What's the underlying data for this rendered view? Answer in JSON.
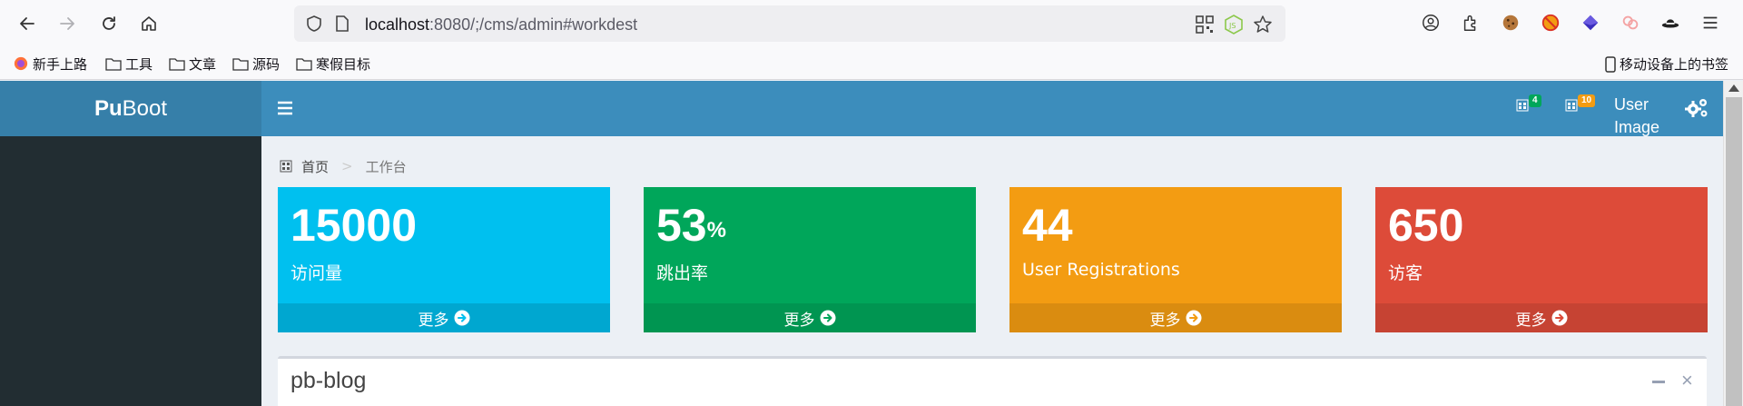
{
  "browser": {
    "url_host": "localhost",
    "url_rest": ":8080/;/cms/admin#workdest",
    "bookmarks": [
      "新手上路",
      "工具",
      "文章",
      "源码",
      "寒假目标"
    ],
    "mobile_bookmarks": "移动设备上的书签"
  },
  "header": {
    "logo_bold": "Pu",
    "logo_rest": "Boot",
    "messages_badge": "4",
    "notifications_badge": "10",
    "user_image_alt": "User Image"
  },
  "breadcrumb": {
    "home": "首页",
    "sep": ">",
    "current": "工作台"
  },
  "stats": [
    {
      "value": "15000",
      "suffix": "",
      "label": "访问量",
      "more": "更多",
      "color": "#00c0ef",
      "footer_color": "#00a7d0"
    },
    {
      "value": "53",
      "suffix": "%",
      "label": "跳出率",
      "more": "更多",
      "color": "#00a65a",
      "footer_color": "#009551"
    },
    {
      "value": "44",
      "suffix": "",
      "label": "User Registrations",
      "more": "更多",
      "color": "#f39c12",
      "footer_color": "#da8c10"
    },
    {
      "value": "650",
      "suffix": "",
      "label": "访客",
      "more": "更多",
      "color": "#dd4b39",
      "footer_color": "#c64333"
    }
  ],
  "panel": {
    "title": "pb-blog",
    "close": "×"
  },
  "colors": {
    "header": "#3c8dbc",
    "logo_bg": "#367fa9",
    "sidebar": "#222d32",
    "content_bg": "#ecf0f5"
  }
}
